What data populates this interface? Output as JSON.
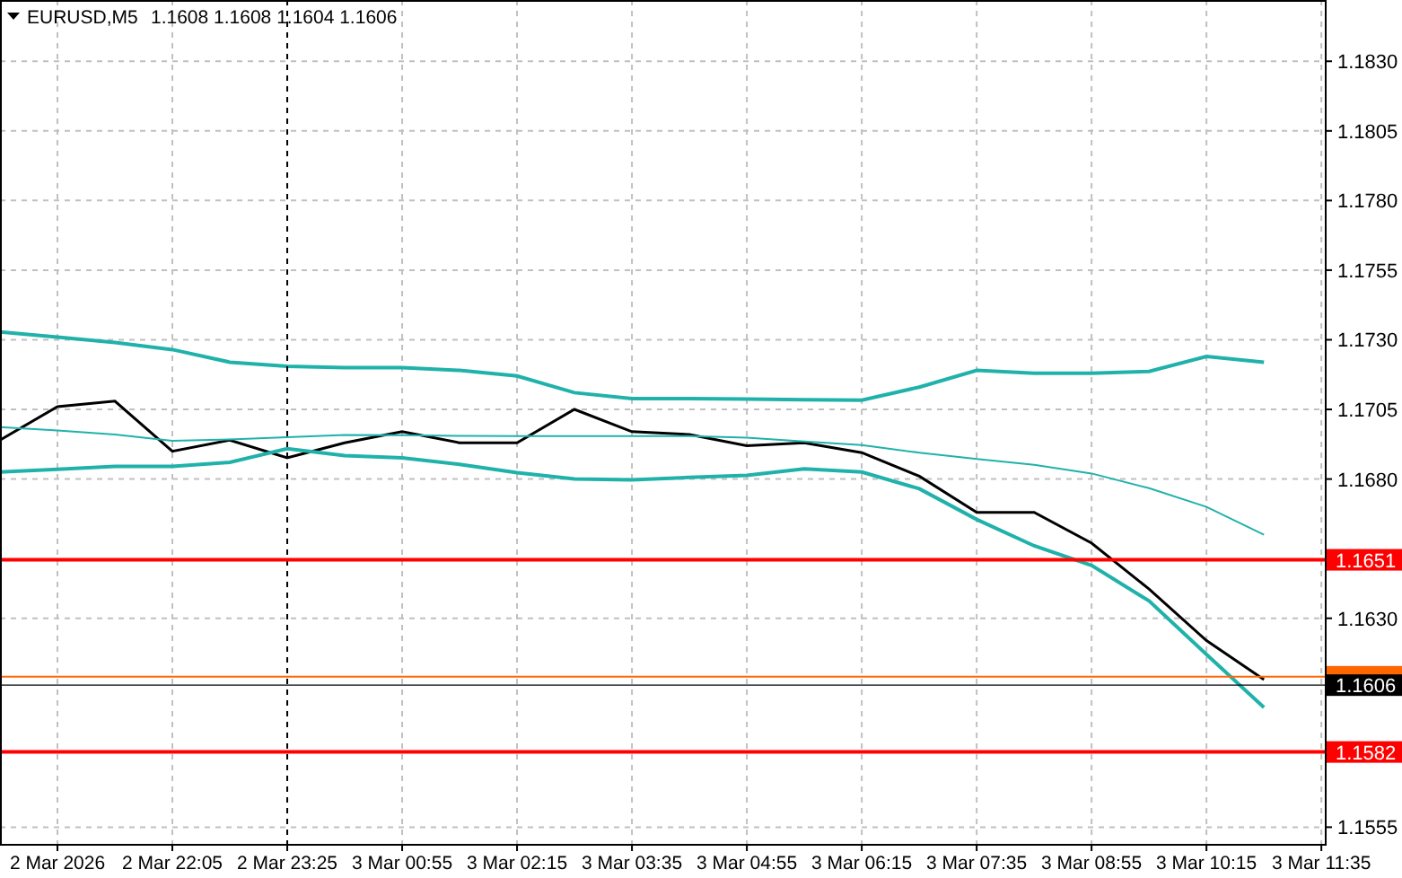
{
  "chart_header": {
    "symbol": "EURUSD,M5",
    "quotes": "1.1608 1.1608 1.1604 1.1606"
  },
  "chart": {
    "chart_data": {
      "type": "line",
      "categories": [
        null,
        "2 Mar 2026",
        null,
        "2 Mar 22:05",
        null,
        "2 Mar 23:25",
        null,
        "3 Mar 00:55",
        null,
        "3 Mar 02:15",
        null,
        "3 Mar 03:35",
        null,
        "3 Mar 04:55",
        null,
        "3 Mar 06:15",
        null,
        "3 Mar 07:35",
        null,
        "3 Mar 08:55",
        null,
        "3 Mar 10:15",
        null,
        "3 Mar 11:35"
      ],
      "series": [
        {
          "color": "#000000",
          "values": [
            1.1694,
            1.1706,
            1.1708,
            1.169,
            1.1694,
            1.16876,
            1.1693,
            1.1697,
            1.1693,
            1.1693,
            1.1705,
            1.1697,
            1.1696,
            1.1692,
            1.1693,
            1.16895,
            1.1681,
            1.1668,
            1.1668,
            1.1657,
            1.16405,
            1.1622,
            1.1608,
            null
          ]
        },
        {
          "color": "#20b2aa",
          "values": [
            1.17328,
            1.1731,
            1.1729,
            1.17265,
            1.1722,
            1.17205,
            1.172,
            1.172,
            1.1719,
            1.1717,
            1.1711,
            1.17089,
            1.17089,
            1.17087,
            1.17085,
            1.17083,
            1.1713,
            1.1719,
            1.1718,
            1.1718,
            1.17186,
            1.1724,
            1.1722,
            null
          ]
        },
        {
          "color": "#20b2aa",
          "values": [
            1.16986,
            1.16975,
            1.1696,
            1.16937,
            1.16942,
            1.1695,
            1.16958,
            1.16957,
            1.16955,
            1.16954,
            1.16954,
            1.16954,
            1.16954,
            1.16949,
            1.16935,
            1.16922,
            1.16895,
            1.16872,
            1.16851,
            1.1682,
            1.16767,
            1.167,
            1.166,
            null
          ]
        },
        {
          "color": "#20b2aa",
          "values": [
            1.16825,
            1.16835,
            1.16845,
            1.16845,
            1.1686,
            1.16909,
            1.16884,
            1.16876,
            1.16853,
            1.16823,
            1.168,
            1.16797,
            1.16806,
            1.16813,
            1.16837,
            1.16825,
            1.16765,
            1.16655,
            1.1656,
            1.1649,
            1.16362,
            1.1617,
            1.1598,
            null
          ]
        }
      ],
      "ylim": [
        1.1549,
        1.1852
      ],
      "yticks": [
        {
          "value": 1.183,
          "label": "1.1830"
        },
        {
          "value": 1.1805,
          "label": "1.1805"
        },
        {
          "value": 1.178,
          "label": "1.1780"
        },
        {
          "value": 1.1755,
          "label": "1.1755"
        },
        {
          "value": 1.173,
          "label": "1.1730"
        },
        {
          "value": 1.1705,
          "label": "1.1705"
        },
        {
          "value": 1.168,
          "label": "1.1680"
        },
        {
          "value": 1.163,
          "label": "1.1630"
        },
        {
          "value": 1.1555,
          "label": "1.1555"
        }
      ],
      "grid": true,
      "ref_lines": [
        {
          "axis": "y",
          "value": 1.1609,
          "color": "#ff6600"
        },
        {
          "axis": "y",
          "value": 1.1651,
          "color": "#ff0000",
          "label": "1.1651"
        },
        {
          "axis": "y",
          "value": 1.1582,
          "color": "#ff0000",
          "label": "1.1582"
        },
        {
          "axis": "y",
          "value": 1.1606,
          "color": "#000000",
          "label": "1.1606"
        }
      ]
    }
  }
}
